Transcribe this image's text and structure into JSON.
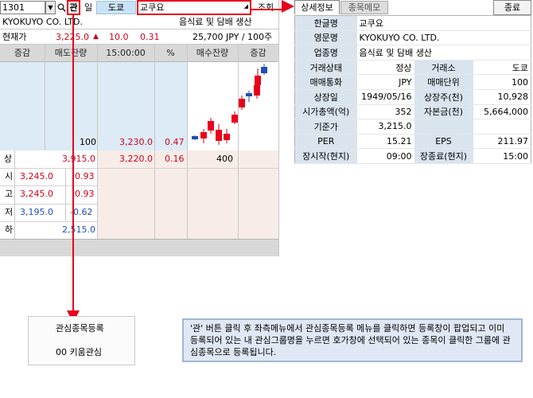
{
  "toolbar": {
    "code": "1301",
    "dropdown_arrow": "▼",
    "search_icon": "🔍",
    "gwan_label": "관",
    "il_label": "일",
    "exchange_label": "도쿄",
    "name_value": "교쿠요",
    "query_label": "조회"
  },
  "stock": {
    "english_name": "KYOKUYO CO. LTD.",
    "category": "음식료 및 담배 생산",
    "current_label": "현재가",
    "price": "3,225.0",
    "change_arrow": "▲",
    "change": "10.0",
    "change_pct": "0.31",
    "volume_info": "25,700 JPY / 100주"
  },
  "grid": {
    "headers": [
      "증감",
      "매도잔량",
      "15:00:00",
      "%",
      "매수잔량",
      "증감"
    ],
    "ask_row": {
      "qty": "100",
      "price": "3,230.0",
      "pct": "0.47"
    },
    "upper_label": "상",
    "upper_value": "3,915.0",
    "bid_row": {
      "price": "3,220.0",
      "pct": "0.16",
      "qty": "400"
    },
    "side_rows": [
      {
        "label": "시",
        "price": "3,245.0",
        "pct": "0.93",
        "color": "#d0021b"
      },
      {
        "label": "고",
        "price": "3,245.0",
        "pct": "0.93",
        "color": "#d0021b"
      },
      {
        "label": "저",
        "price": "3,195.0",
        "pct": "-0.62",
        "color": "#1f4fb0"
      }
    ],
    "lower_label": "하",
    "lower_value": "2,515.0"
  },
  "detail": {
    "tab_active": "상세정보",
    "tab_inactive": "종목메모",
    "close_label": "종료",
    "korean_name_label": "한글명",
    "korean_name": "교쿠요",
    "english_name_label": "영문명",
    "english_name": "KYOKUYO CO. LTD.",
    "industry_label": "업종명",
    "industry": "음식료 및 담배 생산",
    "rows": [
      {
        "l1": "거래상태",
        "v1": "정상",
        "l2": "거래소",
        "v2": "도쿄"
      },
      {
        "l1": "매매통화",
        "v1": "JPY",
        "l2": "매매단위",
        "v2": "100"
      },
      {
        "l1": "상장일",
        "v1": "1949/05/16",
        "l2": "상장주(천)",
        "v2": "10,928"
      },
      {
        "l1": "시가총액(억)",
        "v1": "352",
        "l2": "자본금(천)",
        "v2": "5,664,000"
      },
      {
        "l1": "기준가",
        "v1": "3,215.0",
        "l2": "",
        "v2": ""
      },
      {
        "l1": "PER",
        "v1": "15.21",
        "l2": "EPS",
        "v2": "211.97"
      },
      {
        "l1": "장시작(현지)",
        "v1": "09:00",
        "l2": "장종료(현지)",
        "v2": "15:00"
      }
    ]
  },
  "annotation": {
    "menu_items": [
      "관심종목등록",
      "00 키움관심"
    ],
    "note": "'관' 버튼 클릭 후 좌측메뉴에서 관심종목등록 메뉴를 클릭하면 등록창이 팝업되고 이미 등록되어 있는 내 관심그룹명을 누르면 호가창에 선택되어 있는 종목이 클릭한 그룹에 관심종목으로 등록됩니다."
  },
  "colors": {
    "accent_red": "#e8001c",
    "up": "#d0021b",
    "down": "#1f4fb0"
  }
}
